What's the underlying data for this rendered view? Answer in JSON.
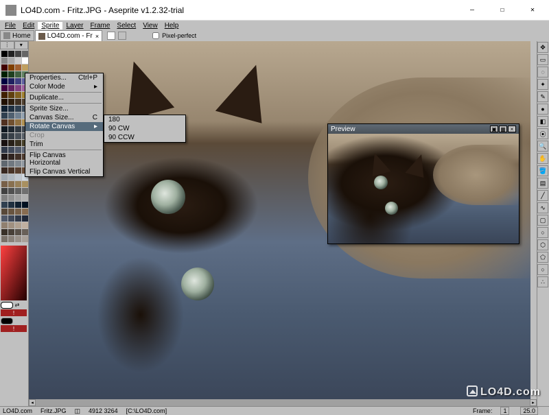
{
  "window": {
    "title": "LO4D.com - Fritz.JPG - Aseprite v1.2.32-trial"
  },
  "menubar": {
    "items": [
      "File",
      "Edit",
      "Sprite",
      "Layer",
      "Frame",
      "Select",
      "View",
      "Help"
    ],
    "active_index": 2
  },
  "tabs": {
    "home_label": "Home",
    "file_label": "LO4D.com - Fr",
    "pixel_perfect_label": "Pixel-perfect"
  },
  "sprite_menu": {
    "properties": "Properties...",
    "properties_shortcut": "Ctrl+P",
    "color_mode": "Color Mode",
    "duplicate": "Duplicate...",
    "sprite_size": "Sprite Size...",
    "canvas_size": "Canvas Size...",
    "canvas_size_shortcut": "C",
    "rotate_canvas": "Rotate Canvas",
    "crop": "Crop",
    "trim": "Trim",
    "flip_h": "Flip Canvas Horizontal",
    "flip_v": "Flip Canvas Vertical"
  },
  "rotate_submenu": {
    "r180": "180",
    "r90cw": "90 CW",
    "r90ccw": "90 CCW"
  },
  "preview": {
    "title": "Preview"
  },
  "palette_colors": [
    "#000000",
    "#222222",
    "#444444",
    "#666666",
    "#888888",
    "#aaaaaa",
    "#cccccc",
    "#ffffff",
    "#400000",
    "#804000",
    "#a06030",
    "#c0a060",
    "#002000",
    "#204020",
    "#406040",
    "#608060",
    "#000040",
    "#202060",
    "#404080",
    "#6060a0",
    "#400040",
    "#602060",
    "#804080",
    "#a060a0",
    "#402000",
    "#604010",
    "#806020",
    "#a08030",
    "#201000",
    "#302010",
    "#403020",
    "#504030",
    "#102030",
    "#203040",
    "#304050",
    "#405060",
    "#304050",
    "#506070",
    "#708090",
    "#90a0b0",
    "#503020",
    "#705030",
    "#907040",
    "#b09050",
    "#101820",
    "#202830",
    "#303840",
    "#404850",
    "#283038",
    "#384048",
    "#485058",
    "#586068",
    "#181010",
    "#282018",
    "#383020",
    "#484028",
    "#303848",
    "#404858",
    "#505868",
    "#606878",
    "#201818",
    "#302420",
    "#403028",
    "#503c30",
    "#606870",
    "#707880",
    "#808890",
    "#9098a0",
    "#382820",
    "#483428",
    "#584030",
    "#684c38",
    "#a0a8b0",
    "#b0b8c0",
    "#c0c8d0",
    "#d0d8e0",
    "#786048",
    "#887050",
    "#988058",
    "#a89060",
    "#404040",
    "#505050",
    "#606060",
    "#707070",
    "#808080",
    "#909090",
    "#a0a0a0",
    "#b0b0b0",
    "#304050",
    "#203040",
    "#102030",
    "#001020",
    "#584838",
    "#685440",
    "#786048",
    "#886c50",
    "#505868",
    "#404858",
    "#303848",
    "#202838",
    "#908070",
    "#a09080",
    "#b0a090",
    "#c0b0a0",
    "#383028",
    "#484038",
    "#585048",
    "#686058",
    "#787068",
    "#888078",
    "#989088",
    "#a8a098"
  ],
  "right_tools": {
    "names": [
      "move-tool",
      "rect-select-tool",
      "lasso-tool",
      "wand-tool",
      "pencil-tool",
      "brush-tool",
      "eraser-tool",
      "eyedropper-tool",
      "zoom-tool",
      "hand-tool",
      "paint-bucket-tool",
      "gradient-tool",
      "line-tool",
      "curve-tool",
      "rectangle-tool",
      "ellipse-tool",
      "contour-tool",
      "polygon-tool",
      "blur-tool",
      "jumble-tool"
    ],
    "glyphs": [
      "✥",
      "▭",
      "◌",
      "✦",
      "✎",
      "●",
      "◧",
      "⦿",
      "🔍",
      "✋",
      "🪣",
      "▤",
      "╱",
      "∿",
      "▢",
      "○",
      "⬡",
      "⬠",
      "○",
      "∴"
    ]
  },
  "statusbar": {
    "site": "LO4D.com",
    "filename": "Fritz.JPG",
    "dimensions": "4912 3264",
    "path": "[C:\\LO4D.com]",
    "frame_label": "Frame:",
    "frame_value": "1",
    "zoom": "25.0"
  },
  "watermark": "LO4D.com"
}
